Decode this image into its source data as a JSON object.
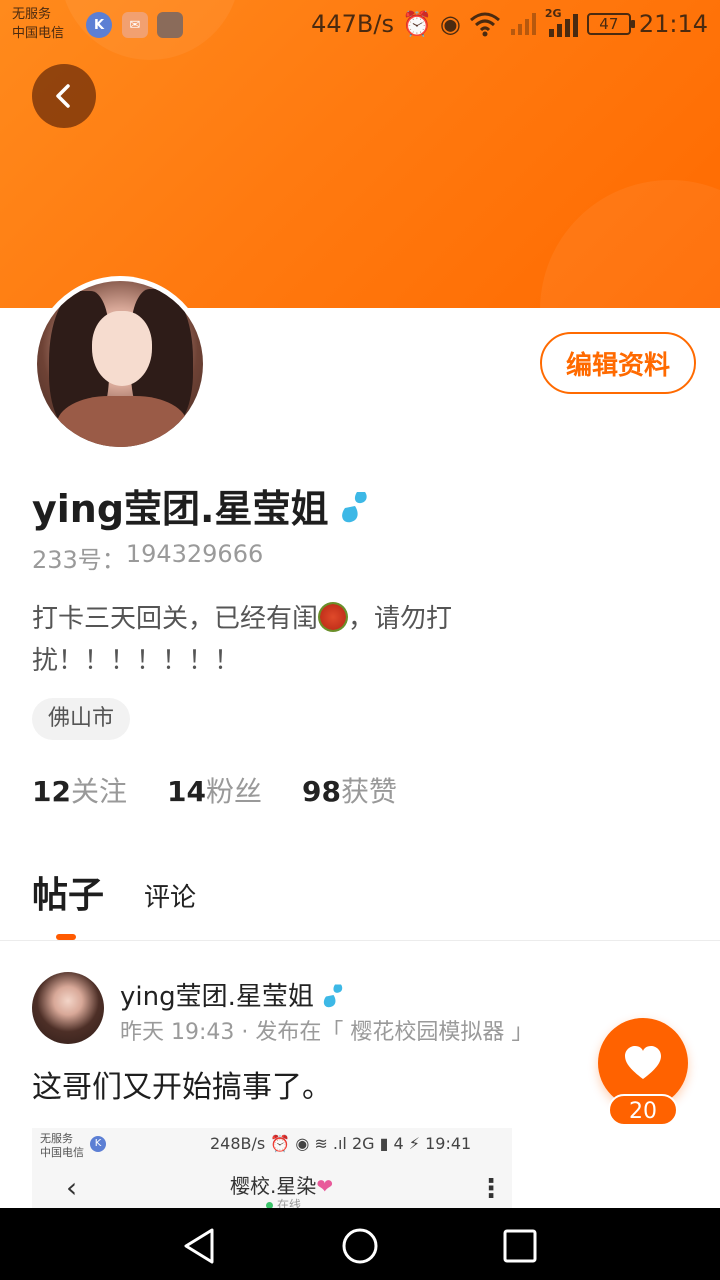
{
  "status_bar": {
    "carrier_line1": "无服务",
    "carrier_line2": "中国电信",
    "app_k": "K",
    "app_mail": "✉",
    "net_speed": "447B/s",
    "alarm_icon": "⏰",
    "eye_icon": "◉",
    "wifi_icon": "wifi",
    "signal_icon": "signal",
    "network": "2G",
    "battery": "47",
    "time": "21:14"
  },
  "profile": {
    "edit_label": "编辑资料",
    "nickname": "ying莹团.星莹姐",
    "uid_label": "233号：",
    "uid_value": "194329666",
    "bio": "打卡三天回关，已经有闺",
    "bio_tail": "，请勿打扰！！！！！！！",
    "location": "佛山市",
    "stats": [
      {
        "num": "12",
        "label": "关注"
      },
      {
        "num": "14",
        "label": "粉丝"
      },
      {
        "num": "98",
        "label": "获赞"
      }
    ]
  },
  "tabs": {
    "posts": "帖子",
    "comments": "评论"
  },
  "post": {
    "author": "ying莹团.星莹姐",
    "meta": "昨天 19:43 · 发布在「 樱花校园模拟器 」",
    "text": "这哥们又开始搞事了。",
    "likes": "20",
    "embed": {
      "carrier_line1": "无服务",
      "carrier_line2": "中国电信",
      "app_k": "K",
      "status": "248B/s ⏰ ◉ ≋ .ıl 2G ▮ 4 ⚡ 19:41",
      "back": "‹",
      "title": "樱校.星染",
      "heart": "❤",
      "subtitle": "在线",
      "more": "⋮"
    }
  },
  "colors": {
    "accent": "#ff6a00",
    "header_start": "#ff8a1c",
    "header_end": "#ff6a00",
    "badge_blue": "#3db8e6"
  }
}
